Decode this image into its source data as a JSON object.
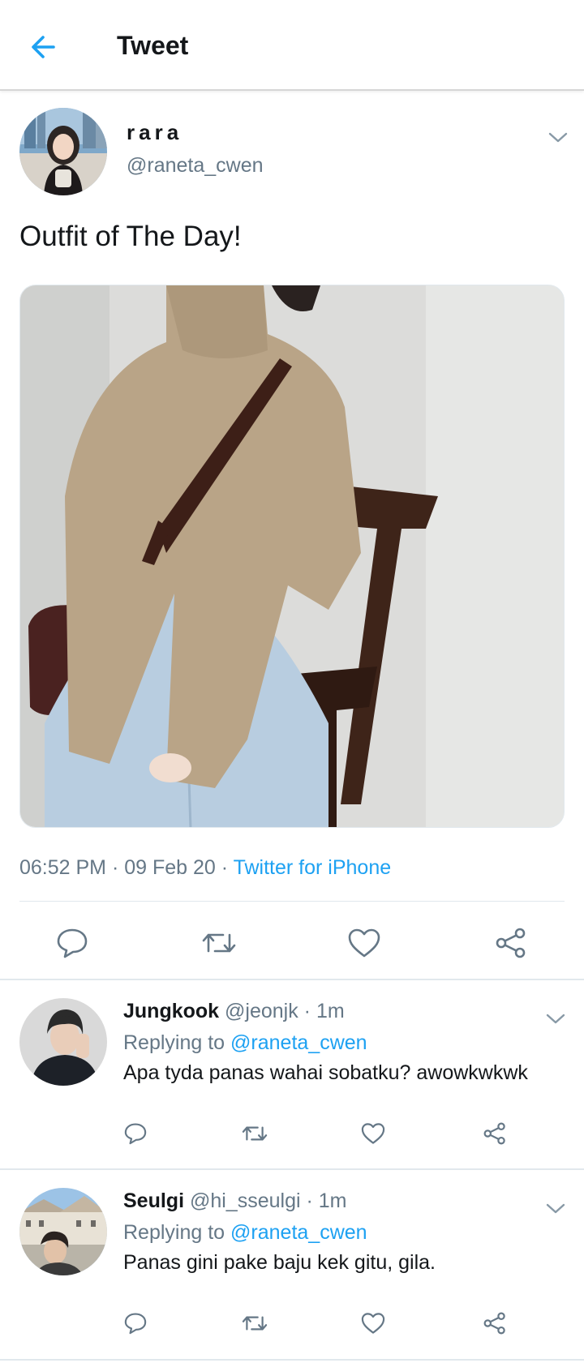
{
  "header": {
    "title": "Tweet",
    "back_icon": "arrow-left-icon"
  },
  "colors": {
    "accent": "#1da1f2",
    "secondary_text": "#657786",
    "primary_text": "#14171a"
  },
  "tweet": {
    "author_name": "rara",
    "author_handle": "@raneta_cwen",
    "text": "Outfit of The Day!",
    "time": "06:52 PM",
    "date": "09 Feb 20",
    "source": "Twitter for iPhone",
    "separator": " · ",
    "actions": [
      "reply-icon",
      "retweet-icon",
      "like-icon",
      "share-icon"
    ]
  },
  "replies": [
    {
      "name": "Jungkook",
      "handle": "@jeonjk",
      "time": "1m",
      "replying_label": "Replying to",
      "replying_to": "@raneta_cwen",
      "text": "Apa tyda panas wahai sobatku? awowkwkwk"
    },
    {
      "name": "Seulgi",
      "handle": "@hi_sseulgi",
      "time": "1m",
      "replying_label": "Replying to",
      "replying_to": "@raneta_cwen",
      "text": "Panas gini pake baju kek gitu, gila."
    }
  ]
}
